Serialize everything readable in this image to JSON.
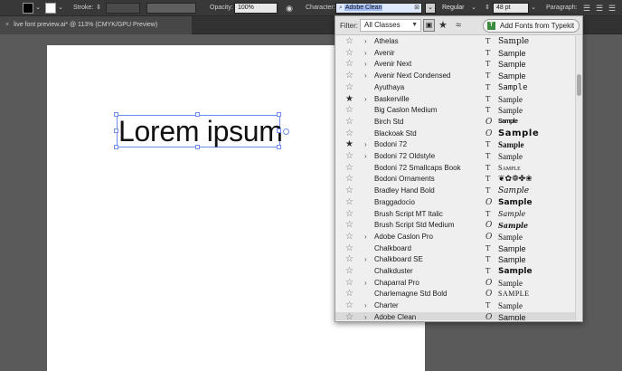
{
  "toolbar": {
    "stroke_label": "Stroke:",
    "opacity_label": "Opacity:",
    "opacity_value": "100%",
    "character_label": "Character:",
    "font_family_value": "Adobe Clean",
    "font_style_value": "Regular",
    "font_size_value": "48 pt",
    "paragraph_label": "Paragraph:",
    "fill_color": "#000000",
    "stroke_color": "#ffffff"
  },
  "document": {
    "tab_title": "live font preview.ai* @ 113% (CMYK/GPU Preview)",
    "close_glyph": "×",
    "canvas_text": "Lorem ipsum"
  },
  "font_menu": {
    "filter_label": "Filter:",
    "filter_value": "All Classes",
    "typekit_label": "Add Fonts from Typekit",
    "fonts": [
      {
        "name": "Athelas",
        "expandable": true,
        "favorite": false,
        "type": "tt",
        "sample": "Sample"
      },
      {
        "name": "Avenir",
        "expandable": true,
        "favorite": false,
        "type": "tt",
        "sample": "Sample"
      },
      {
        "name": "Avenir Next",
        "expandable": true,
        "favorite": false,
        "type": "tt",
        "sample": "Sample"
      },
      {
        "name": "Avenir Next Condensed",
        "expandable": true,
        "favorite": false,
        "type": "tt",
        "sample": "Sample"
      },
      {
        "name": "Ayuthaya",
        "expandable": false,
        "favorite": false,
        "type": "tt",
        "sample": "Sample"
      },
      {
        "name": "Baskerville",
        "expandable": true,
        "favorite": true,
        "type": "tt",
        "sample": "Sample"
      },
      {
        "name": "Big Caslon Medium",
        "expandable": false,
        "favorite": false,
        "type": "tt",
        "sample": "Sample"
      },
      {
        "name": "Birch Std",
        "expandable": false,
        "favorite": false,
        "type": "otf",
        "sample": "Sample"
      },
      {
        "name": "Blackoak Std",
        "expandable": false,
        "favorite": false,
        "type": "otf",
        "sample": "Sample"
      },
      {
        "name": "Bodoni 72",
        "expandable": true,
        "favorite": true,
        "type": "tt",
        "sample": "Sample"
      },
      {
        "name": "Bodoni 72 Oldstyle",
        "expandable": true,
        "favorite": false,
        "type": "tt",
        "sample": "Sample"
      },
      {
        "name": "Bodoni 72 Smallcaps Book",
        "expandable": false,
        "favorite": false,
        "type": "tt",
        "sample": "Sample"
      },
      {
        "name": "Bodoni Ornaments",
        "expandable": false,
        "favorite": false,
        "type": "tt",
        "sample": "❦✿❁✤❀"
      },
      {
        "name": "Bradley Hand Bold",
        "expandable": false,
        "favorite": false,
        "type": "tt",
        "sample": "Sample"
      },
      {
        "name": "Braggadocio",
        "expandable": false,
        "favorite": false,
        "type": "otf",
        "sample": "Sample"
      },
      {
        "name": "Brush Script MT Italic",
        "expandable": false,
        "favorite": false,
        "type": "tt",
        "sample": "Sample"
      },
      {
        "name": "Brush Script Std Medium",
        "expandable": false,
        "favorite": false,
        "type": "otf",
        "sample": "Sample"
      },
      {
        "name": "Adobe Caslon Pro",
        "expandable": true,
        "favorite": false,
        "type": "otf",
        "sample": "Sample"
      },
      {
        "name": "Chalkboard",
        "expandable": false,
        "favorite": false,
        "type": "tt",
        "sample": "Sample"
      },
      {
        "name": "Chalkboard SE",
        "expandable": true,
        "favorite": false,
        "type": "tt",
        "sample": "Sample"
      },
      {
        "name": "Chalkduster",
        "expandable": false,
        "favorite": false,
        "type": "tt",
        "sample": "Sample"
      },
      {
        "name": "Chaparral Pro",
        "expandable": true,
        "favorite": false,
        "type": "otf",
        "sample": "Sample"
      },
      {
        "name": "Charlemagne Std Bold",
        "expandable": false,
        "favorite": false,
        "type": "otf",
        "sample": "SAMPLE"
      },
      {
        "name": "Charter",
        "expandable": true,
        "favorite": false,
        "type": "tt",
        "sample": "Sample"
      },
      {
        "name": "Adobe Clean",
        "expandable": true,
        "favorite": false,
        "type": "otf",
        "sample": "Sample"
      }
    ]
  }
}
